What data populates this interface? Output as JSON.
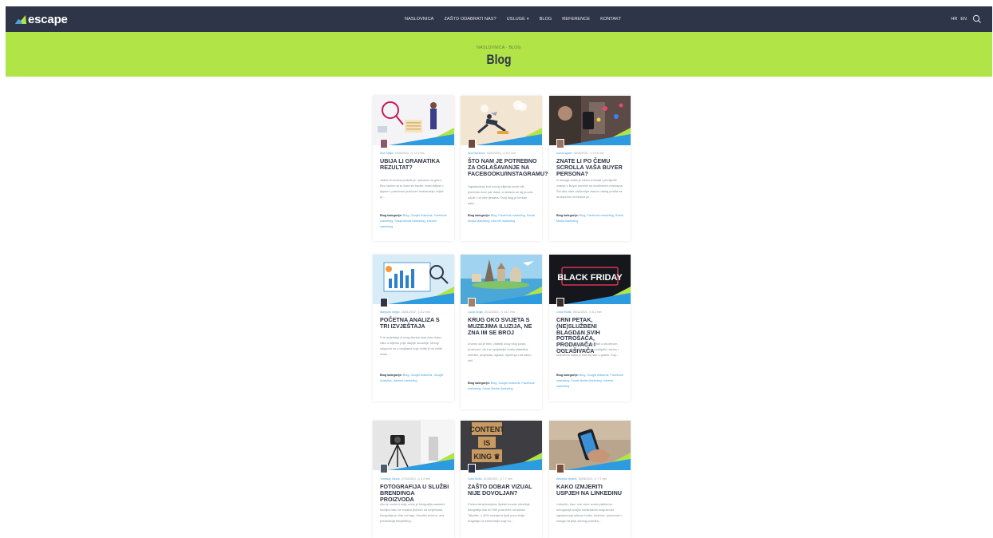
{
  "brand": {
    "name": "escape"
  },
  "nav": {
    "items": [
      "NASLOVNICA",
      "ZAŠTO ODABRATI NAS?",
      "USLUGE",
      "BLOG",
      "REFERENCE",
      "KONTAKT"
    ],
    "languages": [
      "HR",
      "EN"
    ]
  },
  "hero": {
    "breadcrumb": "NASLOVNICA · BLOG",
    "title": "Blog"
  },
  "colors": {
    "nav_bg": "#2e3548",
    "accent_green": "#b1e446",
    "link_blue": "#4aa3df"
  },
  "posts": [
    {
      "author": "Ana Šiblja",
      "date": "14/06/2022",
      "read": "12.9 min",
      "title": "UBIJA LI GRAMATIKA REZULTAT?",
      "excerpt": "Jedna Drvenica postala je i pticama na grani. Bez obzira na to čime se bavite, imati svijest o ljepom i pravilnom jezičnom izražavanju uvijek je…",
      "cat_label": "Blog kategorije:",
      "categories": "Blog, Google Adwords, Facebook marketing, Social Media Marketing, Internet marketing"
    },
    {
      "author": "Ana Marković",
      "date": "18/02/2022",
      "read": "6.3 min",
      "title": "ŠTO NAM JE POTREBNO ZA OGLAŠAVANJE NA FACEBOOKU/INSTAGRAMU?",
      "excerpt": "Oglašavanje kod novog klijenta može biti pionirsko kroz par dana, a nekada se taj proces oduži i na više tjedana. Ovaj blog je kreiran kako…",
      "cat_label": "Blog kategorije:",
      "categories": "Blog, Facebook marketing, Social Media Marketing, Internet marketing"
    },
    {
      "author": "Ivana Agatić",
      "date": "04/02/2022",
      "read": "10.6 min",
      "title": "ZNATE LI PO ČEMU SCROLLA VAŠA BUYER PERSONA?",
      "excerpt": "S razloga zašto je važno imenati i primijeniti znanje o Buyer personi na društvenim mrežama. Što ako niste zadovoljni rastom vašeg profila na društvenim mrežama jer…",
      "cat_label": "Blog kategorije:",
      "categories": "Blog, Facebook marketing, Social Media Marketing"
    },
    {
      "author": "Marijana Vargić",
      "date": "18/01/2022",
      "read": "8.2 min",
      "title": "POČETNA ANALIZA S TRI IZVJEŠTAJA",
      "excerpt": "S tri izvještaja iz ovog članka imat ćete dobru sliku o klijentu prije daljnje suradnje. Mnogi odgovori su u brojkama koje vidite ili ne vidite često…",
      "cat_label": "Blog kategorije:",
      "categories": "Blog, Google Adwords, Google Analytics, Internet marketing"
    },
    {
      "author": "Lucia Grujić",
      "date": "20/12/2021",
      "read": "14.7 min",
      "title": "KRUG OKO SVIJETA S MUZEJIMA ILUZIJA, NE ZNA IM SE BROJ",
      "excerpt": "Znamo da je rekli, čitatelji ovog blog posta proizvaci i da ti je sprijateljio dosta statistika, metrika, projekata, oglasa, mjerenja i da samo želi…",
      "cat_label": "Blog kategorije:",
      "categories": "Blog, Google Adwords, Facebook marketing, Social Media Marketing"
    },
    {
      "author": "Linda Hudić",
      "date": "09/11/2021",
      "read": "6.2 min",
      "title": "CRNI PETAK, (NE)SLUŽBENI BLAGDAN SVIH POTROŠAČA, PRODAVAČA I OGLAŠIVAČA",
      "excerpt": "Crni petak pada na četvrti petak u studenom. Postoji puno verzija priča o podrijetlu naziva i razlozima zašto je baš taj dan u godini. Koji…",
      "cat_label": "Blog kategorije:",
      "categories": "Blog, Google Adwords, Facebook marketing, Social Media Marketing, Internet marketing"
    },
    {
      "author": "Tomislav Dlunić",
      "date": "07/10/2021",
      "read": "4.2 min",
      "title": "FOTOGRAFIJA U SLUŽBI BRENDINGA PROIZVODA",
      "excerpt": "Ako je content kralj, onda je fotografija sastavni krunjica iako se smatra jednom od umjetnosti, fotografija je više od toga. Ukratko rečeno, ona predstavlja storytelling…",
      "cat_label": "",
      "categories": ""
    },
    {
      "author": "Luka Ružić",
      "date": "31/08/2021",
      "read": "7.7 min",
      "title": "ZAŠTO DOBAR VIZUAL NIJE DOVOLJAN?",
      "excerpt": "Prema istraživanjima, ljudski mozak obrađuje fotografiju čak 60 000 puta brže od teksta. Također, u 40% slučajeva ljudi puno bolje reagiraju na informacije koje su…",
      "cat_label": "",
      "categories": ""
    },
    {
      "author": "Antonija Vejačić",
      "date": "28/08/2021",
      "read": "7.1 min",
      "title": "KAKO IZMJERITI USPJEH NA LINKEDINU",
      "excerpt": "LinkedIn, kao i sve veće social platforme, omogućuje svojim korisnicima mogućnost oglašavanja njihove tvrtke, stranice, proizvoda i usluga na prije samog početka…",
      "cat_label": "",
      "categories": ""
    }
  ]
}
